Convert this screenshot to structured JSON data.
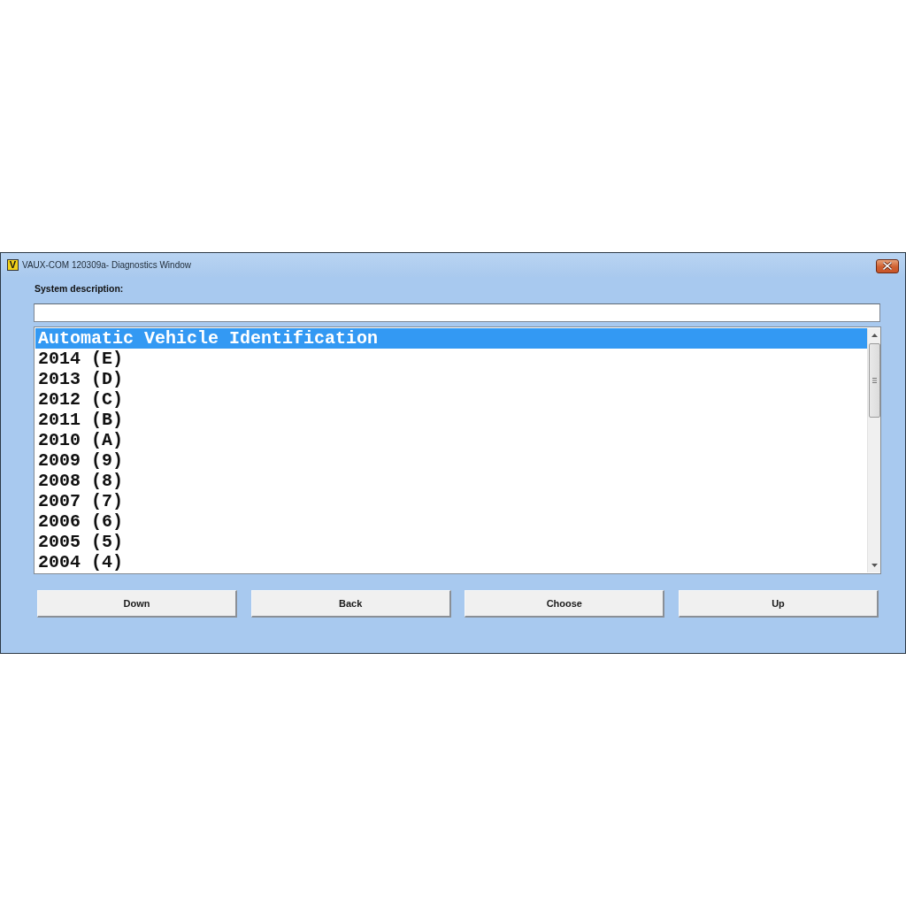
{
  "window": {
    "logo": "V",
    "title": "VAUX-COM 120309a- Diagnostics Window"
  },
  "system_description": {
    "label": "System description:"
  },
  "list": {
    "items": [
      {
        "label": "Automatic Vehicle Identification",
        "selected": true
      },
      {
        "label": "2014 (E)",
        "selected": false
      },
      {
        "label": "2013 (D)",
        "selected": false
      },
      {
        "label": "2012 (C)",
        "selected": false
      },
      {
        "label": "2011 (B)",
        "selected": false
      },
      {
        "label": "2010 (A)",
        "selected": false
      },
      {
        "label": "2009 (9)",
        "selected": false
      },
      {
        "label": "2008 (8)",
        "selected": false
      },
      {
        "label": "2007 (7)",
        "selected": false
      },
      {
        "label": "2006 (6)",
        "selected": false
      },
      {
        "label": "2005 (5)",
        "selected": false
      },
      {
        "label": "2004 (4)",
        "selected": false
      }
    ]
  },
  "buttons": [
    "Down",
    "Back",
    "Choose",
    "Up"
  ]
}
